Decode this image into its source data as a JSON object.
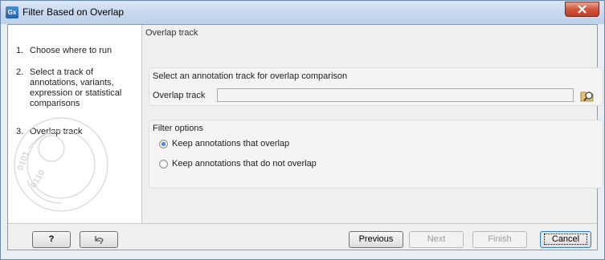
{
  "window": {
    "app_icon": "Gx",
    "title": "Filter Based on Overlap"
  },
  "steps": [
    {
      "num": "1.",
      "label": "Choose where to run"
    },
    {
      "num": "2.",
      "label": "Select a track of annotations, variants, expression or statistical comparisons"
    },
    {
      "num": "3.",
      "label": "Overlap track"
    }
  ],
  "main": {
    "title": "Overlap track",
    "select_group": {
      "title": "Select an annotation track for overlap comparison",
      "field_label": "Overlap track",
      "field_value": ""
    },
    "filter_group": {
      "title": "Filter options",
      "options": [
        {
          "label": "Keep annotations that overlap",
          "selected": true
        },
        {
          "label": "Keep annotations that do not overlap",
          "selected": false
        }
      ]
    }
  },
  "buttons": {
    "help": "?",
    "previous": "Previous",
    "next": "Next",
    "finish": "Finish",
    "cancel": "Cancel"
  }
}
